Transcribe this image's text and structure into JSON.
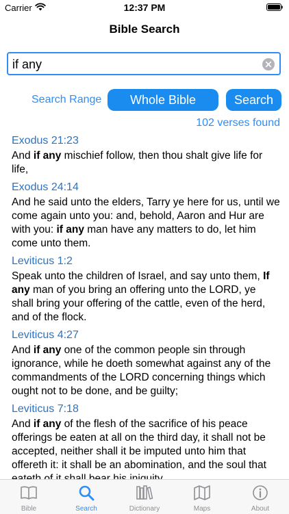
{
  "status_bar": {
    "carrier": "Carrier",
    "time": "12:37 PM"
  },
  "nav": {
    "title": "Bible Search"
  },
  "search": {
    "value": "if any"
  },
  "controls": {
    "search_range_label": "Search Range",
    "range_value": "Whole Bible",
    "search_label": "Search"
  },
  "results_count": "102 verses found",
  "results": [
    {
      "ref": "Exodus 21:23",
      "before": "And ",
      "match": "if any",
      "after": " mischief follow, then thou shalt give life for life,"
    },
    {
      "ref": "Exodus 24:14",
      "before": "And he said unto the elders, Tarry ye here for us, until we come again unto you: and, behold, Aaron and Hur are with you: ",
      "match": "if any",
      "after": " man have any matters to do, let him come unto them."
    },
    {
      "ref": "Leviticus 1:2",
      "before": "Speak unto the children of Israel, and say unto them, ",
      "match": "If any",
      "after": " man of you bring an offering unto the LORD, ye shall bring your offering of the cattle, even of the herd, and of the flock."
    },
    {
      "ref": "Leviticus 4:27",
      "before": "And ",
      "match": "if any",
      "after": " one of the common people sin through ignorance, while he doeth somewhat against any of the commandments of the LORD concerning things which ought not to be done, and be guilty;"
    },
    {
      "ref": "Leviticus 7:18",
      "before": "And ",
      "match": "if any",
      "after": " of the flesh of the sacrifice of his peace offerings be eaten at all on the third day, it shall not be accepted, neither shall it be imputed unto him that offereth it: it shall be an abomination, and the soul that eateth of it shall bear his iniquity."
    }
  ],
  "tabs": [
    {
      "label": "Bible",
      "icon": "book-icon"
    },
    {
      "label": "Search",
      "icon": "magnifier-icon"
    },
    {
      "label": "Dictionary",
      "icon": "books-icon"
    },
    {
      "label": "Maps",
      "icon": "map-icon"
    },
    {
      "label": "About",
      "icon": "info-icon"
    }
  ],
  "colors": {
    "accent": "#1a8cf0",
    "link": "#2f72bd",
    "inactive_tab": "#8e8e93"
  }
}
